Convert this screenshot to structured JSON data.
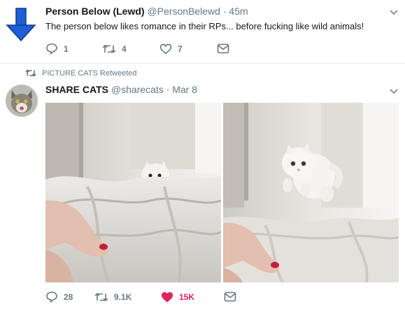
{
  "tweet1": {
    "display_name": "Person Below (Lewd)",
    "handle": "@PersonBelewd",
    "separator": "·",
    "time": "45m",
    "text": "The person below likes romance in their RPs... before fucking like wild animals!",
    "actions": {
      "reply_count": "1",
      "retweet_count": "4",
      "like_count": "7"
    },
    "icons": [
      "arrow-down-icon",
      "reply-icon",
      "retweet-icon",
      "heart-icon",
      "envelope-icon",
      "chevron-down-icon"
    ],
    "arrow_color": "#1f5fd6"
  },
  "tweet2": {
    "retweeted_by": "PICTURE CATS Retweeted",
    "display_name": "SHARE CATS",
    "handle": "@sharecats",
    "separator": "·",
    "time": "Mar 8",
    "actions": {
      "reply_count": "28",
      "retweet_count": "9.1K",
      "like_count": "15K"
    },
    "liked": true,
    "like_color": "#e0245e",
    "icons": [
      "retweet-icon",
      "reply-icon",
      "heart-icon",
      "envelope-icon",
      "chevron-down-icon"
    ],
    "media": [
      "cat-peeking-photo",
      "cat-jumping-photo"
    ]
  }
}
